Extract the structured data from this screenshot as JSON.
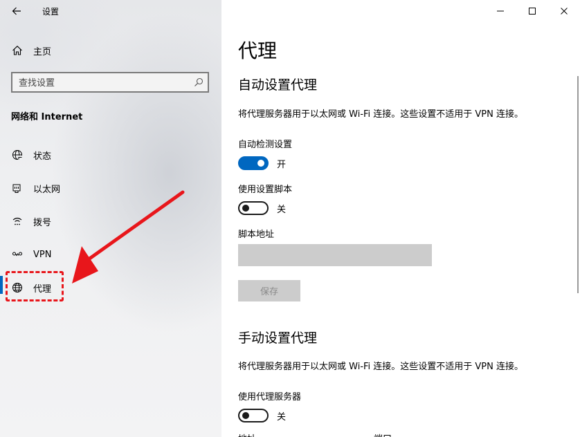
{
  "app": {
    "title": "设置"
  },
  "sidebar": {
    "home_label": "主页",
    "search": {
      "placeholder": "查找设置",
      "value": ""
    },
    "section_heading": "网络和 Internet",
    "items": [
      {
        "label": "状态",
        "icon": "globe-status-icon",
        "active": false
      },
      {
        "label": "以太网",
        "icon": "ethernet-icon",
        "active": false
      },
      {
        "label": "拨号",
        "icon": "dialup-icon",
        "active": false
      },
      {
        "label": "VPN",
        "icon": "vpn-icon",
        "active": false
      },
      {
        "label": "代理",
        "icon": "globe-icon",
        "active": true
      }
    ]
  },
  "main": {
    "page_title": "代理",
    "auto": {
      "heading": "自动设置代理",
      "description": "将代理服务器用于以太网或 Wi-Fi 连接。这些设置不适用于 VPN 连接。",
      "detect": {
        "label": "自动检测设置",
        "state": "开",
        "on": true
      },
      "script": {
        "label": "使用设置脚本",
        "state": "关",
        "on": false
      },
      "script_address": {
        "label": "脚本地址",
        "value": ""
      },
      "save_label": "保存"
    },
    "manual": {
      "heading": "手动设置代理",
      "description": "将代理服务器用于以太网或 Wi-Fi 连接。这些设置不适用于 VPN 连接。",
      "use_proxy": {
        "label": "使用代理服务器",
        "state": "关",
        "on": false
      },
      "cut_labels": [
        "地址",
        "端口"
      ]
    }
  },
  "colors": {
    "accent": "#0067c0",
    "annotation": "#e8161b",
    "disabled_fill": "#cccccc"
  }
}
